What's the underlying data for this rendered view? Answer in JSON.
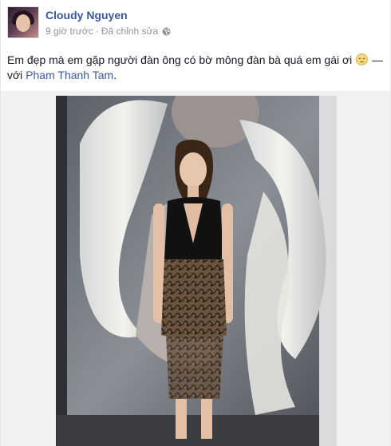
{
  "post": {
    "author": "Cloudy Nguyen",
    "time": "9 giờ trước",
    "separator": "·",
    "edited": "Đã chỉnh sửa",
    "privacy_icon": "globe-icon",
    "text_main": "Em đẹp mà em gặp người đàn ông có bờ mông đàn bà quá em gái ơi",
    "emoji": "disappointed-face-icon",
    "with_prefix": " — với ",
    "tagged_person": "Pham Thanh Tam",
    "period": "."
  },
  "colors": {
    "link": "#3b5998",
    "meta": "#90949c",
    "text": "#141823"
  }
}
